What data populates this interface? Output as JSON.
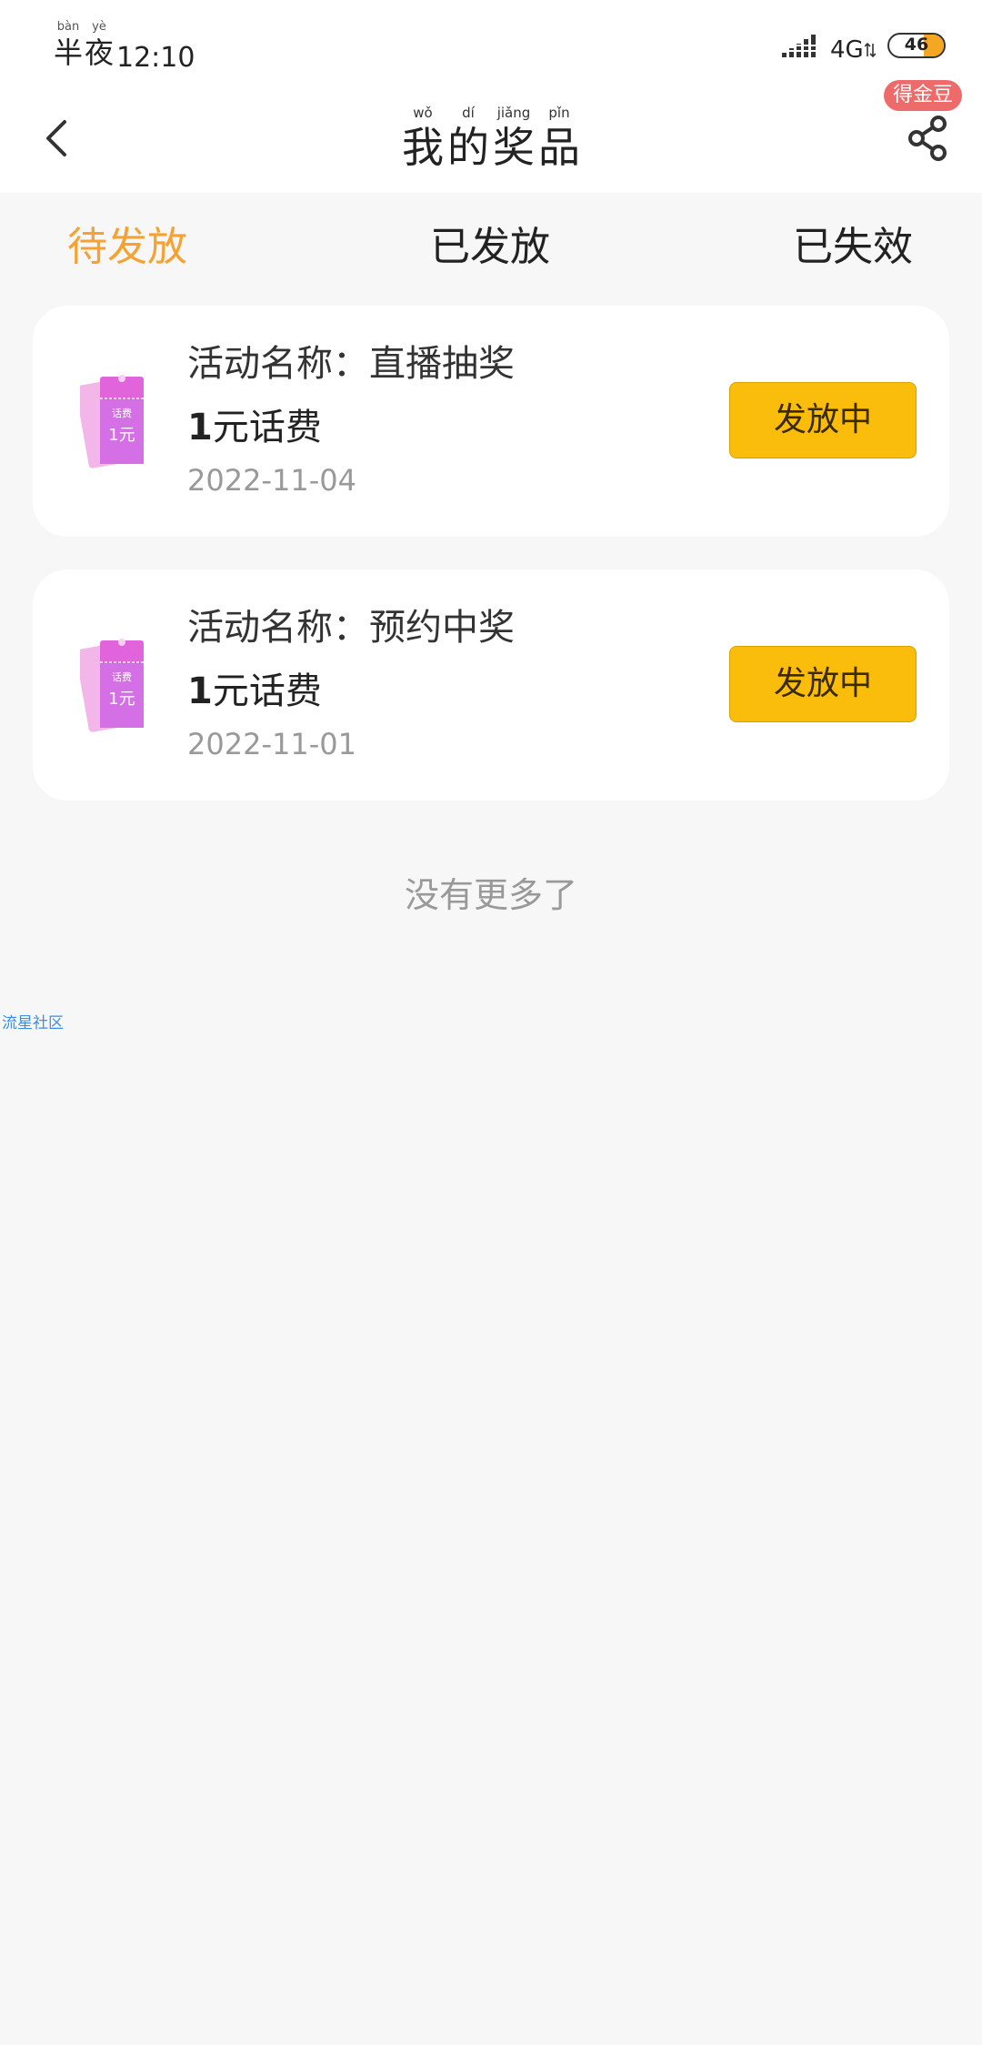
{
  "status_bar": {
    "period_chars": [
      {
        "pinyin": "bàn",
        "char": "半"
      },
      {
        "pinyin": "yè",
        "char": "夜"
      }
    ],
    "time": "12:10",
    "network": "4G",
    "battery": "46",
    "battery_color": "#f5a623"
  },
  "header": {
    "title_chars": [
      {
        "pinyin": "wǒ",
        "char": "我"
      },
      {
        "pinyin": "dí",
        "char": "的"
      },
      {
        "pinyin": "jiǎng",
        "char": "奖"
      },
      {
        "pinyin": "pǐn",
        "char": "品"
      }
    ],
    "badge": "得金豆",
    "back_icon": "chevron-left-icon",
    "share_icon": "share-icon"
  },
  "tabs": [
    {
      "label": "待发放",
      "active": true
    },
    {
      "label": "已发放",
      "active": false
    },
    {
      "label": "已失效",
      "active": false
    }
  ],
  "accent_color": "#f5a233",
  "button_color": "#fbbd0b",
  "prizes": [
    {
      "activity": "活动名称：直播抽奖",
      "prize_amount": "1",
      "prize_unit": "元话费",
      "date": "2022-11-04",
      "status": "发放中",
      "ticket_top": "话费",
      "ticket_value": "1元"
    },
    {
      "activity": "活动名称：预约中奖",
      "prize_amount": "1",
      "prize_unit": "元话费",
      "date": "2022-11-01",
      "status": "发放中",
      "ticket_top": "话费",
      "ticket_value": "1元"
    }
  ],
  "footer": {
    "no_more": "没有更多了",
    "watermark": "流星社区"
  }
}
